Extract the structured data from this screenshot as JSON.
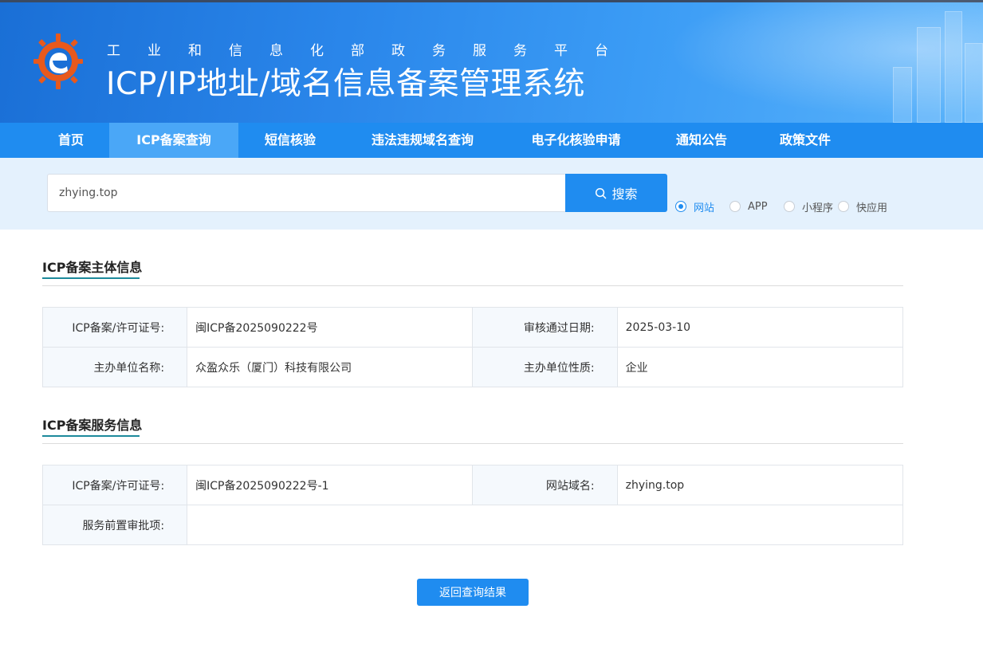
{
  "header": {
    "subtitle": "工业和信息化部政务服务平台",
    "title": "ICP/IP地址/域名信息备案管理系统"
  },
  "nav": {
    "items": [
      {
        "label": "首页",
        "active": false
      },
      {
        "label": "ICP备案查询",
        "active": true
      },
      {
        "label": "短信核验",
        "active": false
      },
      {
        "label": "违法违规域名查询",
        "active": false
      },
      {
        "label": "电子化核验申请",
        "active": false
      },
      {
        "label": "通知公告",
        "active": false
      },
      {
        "label": "政策文件",
        "active": false
      }
    ]
  },
  "search": {
    "value": "zhying.top",
    "button_label": "搜索",
    "types": [
      {
        "label": "网站",
        "checked": true
      },
      {
        "label": "APP",
        "checked": false
      },
      {
        "label": "小程序",
        "checked": false
      },
      {
        "label": "快应用",
        "checked": false
      }
    ]
  },
  "subject_section": {
    "title": "ICP备案主体信息",
    "rows": [
      {
        "label1": "ICP备案/许可证号:",
        "value1": "闽ICP备2025090222号",
        "label2": "审核通过日期:",
        "value2": "2025-03-10"
      },
      {
        "label1": "主办单位名称:",
        "value1": "众盈众乐（厦门）科技有限公司",
        "label2": "主办单位性质:",
        "value2": "企业"
      }
    ]
  },
  "service_section": {
    "title": "ICP备案服务信息",
    "row1": {
      "label1": "ICP备案/许可证号:",
      "value1": "闽ICP备2025090222号-1",
      "label2": "网站域名:",
      "value2": "zhying.top"
    },
    "row2": {
      "label": "服务前置审批项:",
      "value": ""
    }
  },
  "back_button": "返回查询结果",
  "colors": {
    "primary": "#1f8cf0",
    "nav_active": "#4aa7f7",
    "search_bg": "#e4f1fd",
    "underline": "#1d8a9b"
  }
}
